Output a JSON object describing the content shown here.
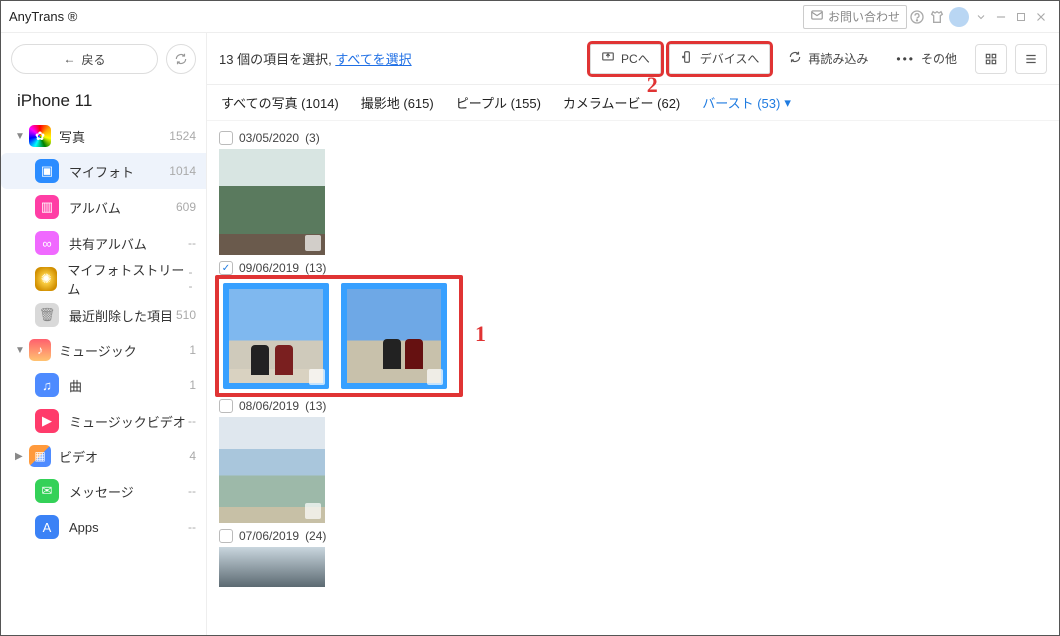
{
  "titlebar": {
    "app_name": "AnyTrans ®",
    "contact_label": "お問い合わせ"
  },
  "sidebar": {
    "back_label": "戻る",
    "device_name": "iPhone 11",
    "sections": [
      {
        "label": "写真",
        "count": "1524",
        "items": [
          {
            "label": "マイフォト",
            "count": "1014",
            "selected": true
          },
          {
            "label": "アルバム",
            "count": "609"
          },
          {
            "label": "共有アルバム",
            "count": "--"
          },
          {
            "label": "マイフォトストリーム",
            "count": "--"
          },
          {
            "label": "最近削除した項目",
            "count": "510"
          }
        ]
      },
      {
        "label": "ミュージック",
        "count": "1",
        "items": [
          {
            "label": "曲",
            "count": "1"
          },
          {
            "label": "ミュージックビデオ",
            "count": "--"
          }
        ]
      },
      {
        "label": "ビデオ",
        "count": "4",
        "items": []
      },
      {
        "label": "メッセージ",
        "count": "--",
        "items": []
      },
      {
        "label": "Apps",
        "count": "--",
        "items": []
      }
    ]
  },
  "toolbar": {
    "selection_prefix": "13 個の項目を選択,",
    "select_all": "すべてを選択",
    "to_pc": "PCへ",
    "to_device": "デバイスへ",
    "reload": "再読み込み",
    "more": "その他"
  },
  "tabs": {
    "all_photos": "すべての写真 (1014)",
    "places": "撮影地 (615)",
    "people": "ピープル (155)",
    "camera": "カメラムービー (62)",
    "burst": "バースト (53)"
  },
  "groups": [
    {
      "date": "03/05/2020",
      "count": "(3)",
      "checked": false,
      "thumbs": [
        {
          "type": "ph-trees"
        }
      ]
    },
    {
      "date": "09/06/2019",
      "count": "(13)",
      "checked": true,
      "thumbs": [
        {
          "type": "ph-jump",
          "sel": true
        },
        {
          "type": "ph-walk",
          "sel": true
        }
      ]
    },
    {
      "date": "08/06/2019",
      "count": "(13)",
      "checked": false,
      "thumbs": [
        {
          "type": "ph-cloud"
        }
      ]
    },
    {
      "date": "07/06/2019",
      "count": "(24)",
      "checked": false,
      "thumbs": [
        {
          "type": "ph-grad"
        }
      ]
    }
  ],
  "annotations": {
    "n1": "1",
    "n2": "2",
    "callout_buttons": [
      "to_pc",
      "to_device"
    ]
  },
  "colors": {
    "callout": "#e03434",
    "link": "#1f7be0",
    "sel_bg": "#37a0ff"
  }
}
